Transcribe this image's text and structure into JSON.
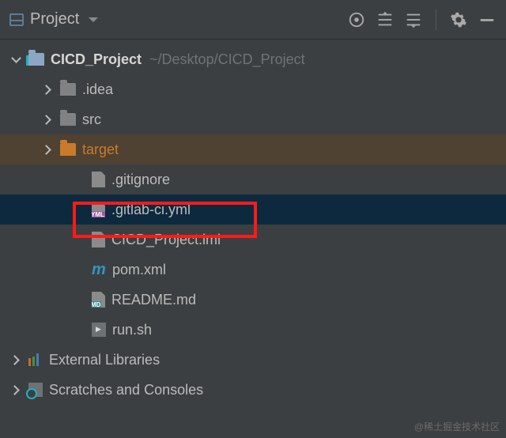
{
  "toolbar": {
    "project_label": "Project"
  },
  "tree": {
    "root": {
      "name": "CICD_Project",
      "path": "~/Desktop/CICD_Project"
    },
    "children": [
      {
        "name": ".idea"
      },
      {
        "name": "src"
      },
      {
        "name": "target"
      },
      {
        "name": ".gitignore"
      },
      {
        "name": ".gitlab-ci.yml"
      },
      {
        "name": "CICD_Project.iml"
      },
      {
        "name": "pom.xml"
      },
      {
        "name": "README.md"
      },
      {
        "name": "run.sh"
      }
    ],
    "external_libraries": "External Libraries",
    "scratches": "Scratches and Consoles"
  },
  "watermark": "@稀土掘金技术社区"
}
